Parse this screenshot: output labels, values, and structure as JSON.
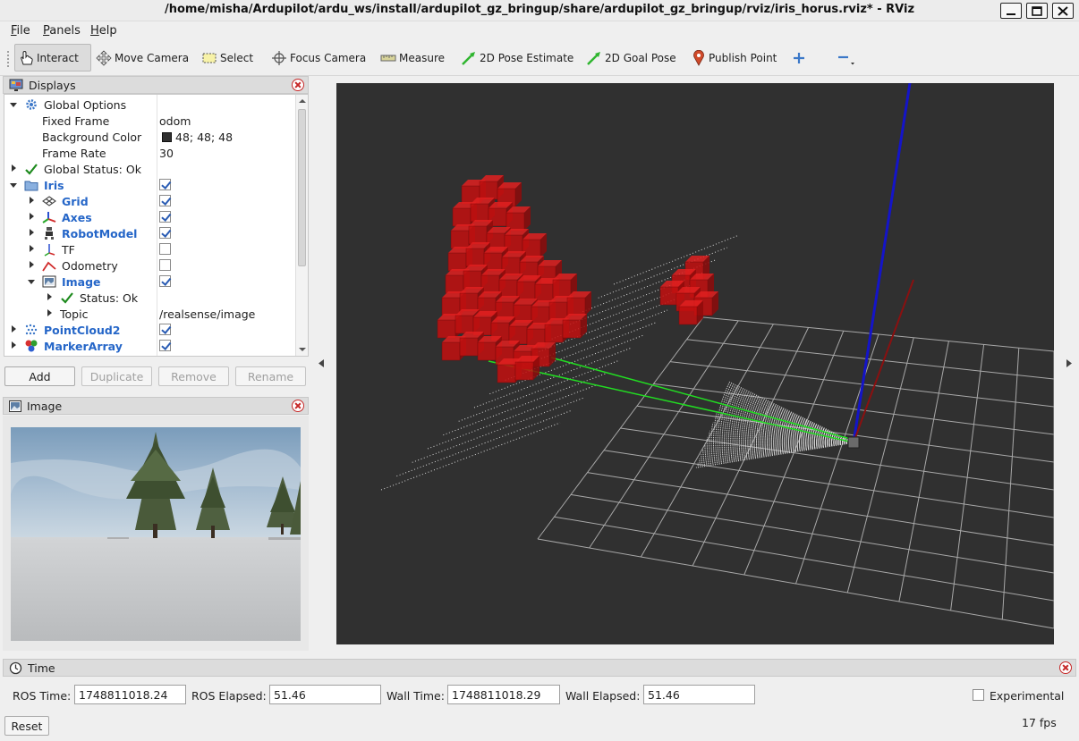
{
  "window": {
    "title": "/home/misha/Ardupilot/ardu_ws/install/ardupilot_gz_bringup/share/ardupilot_gz_bringup/rviz/iris_horus.rviz* - RViz"
  },
  "menu": [
    "File",
    "Panels",
    "Help"
  ],
  "toolbar": {
    "interact": "Interact",
    "move_camera": "Move Camera",
    "select": "Select",
    "focus_camera": "Focus Camera",
    "measure": "Measure",
    "pose_estimate": "2D Pose Estimate",
    "goal_pose": "2D Goal Pose",
    "publish_point": "Publish Point"
  },
  "displays": {
    "title": "Displays",
    "rows": {
      "global_options": "Global Options",
      "fixed_frame": {
        "label": "Fixed Frame",
        "value": "odom"
      },
      "background_color": {
        "label": "Background Color",
        "value": "48; 48; 48",
        "swatch": "#303030"
      },
      "frame_rate": {
        "label": "Frame Rate",
        "value": "30"
      },
      "global_status": "Global Status: Ok",
      "iris": {
        "label": "Iris",
        "checked": true
      },
      "grid": {
        "label": "Grid",
        "checked": true
      },
      "axes": {
        "label": "Axes",
        "checked": true
      },
      "robot_model": {
        "label": "RobotModel",
        "checked": true
      },
      "tf": {
        "label": "TF",
        "checked": false
      },
      "odometry": {
        "label": "Odometry",
        "checked": false
      },
      "image": {
        "label": "Image",
        "checked": true
      },
      "image_status": "Status: Ok",
      "topic": {
        "label": "Topic",
        "value": "/realsense/image"
      },
      "pointcloud2": {
        "label": "PointCloud2",
        "checked": true
      },
      "marker_array": {
        "label": "MarkerArray",
        "checked": true
      }
    },
    "buttons": {
      "add": "Add",
      "duplicate": "Duplicate",
      "remove": "Remove",
      "rename": "Rename"
    }
  },
  "image_panel": {
    "title": "Image"
  },
  "time": {
    "title": "Time",
    "ros_time_label": "ROS Time:",
    "ros_time": "1748811018.24",
    "ros_elapsed_label": "ROS Elapsed:",
    "ros_elapsed": "51.46",
    "wall_time_label": "Wall Time:",
    "wall_time": "1748811018.29",
    "wall_elapsed_label": "Wall Elapsed:",
    "wall_elapsed": "51.46",
    "experimental": "Experimental",
    "reset": "Reset",
    "fps": "17 fps"
  },
  "colors": {
    "accent_blue": "#2566c8",
    "viewport_bg": "#303030",
    "voxel_red": "#c31010",
    "close_red": "#c62828"
  }
}
